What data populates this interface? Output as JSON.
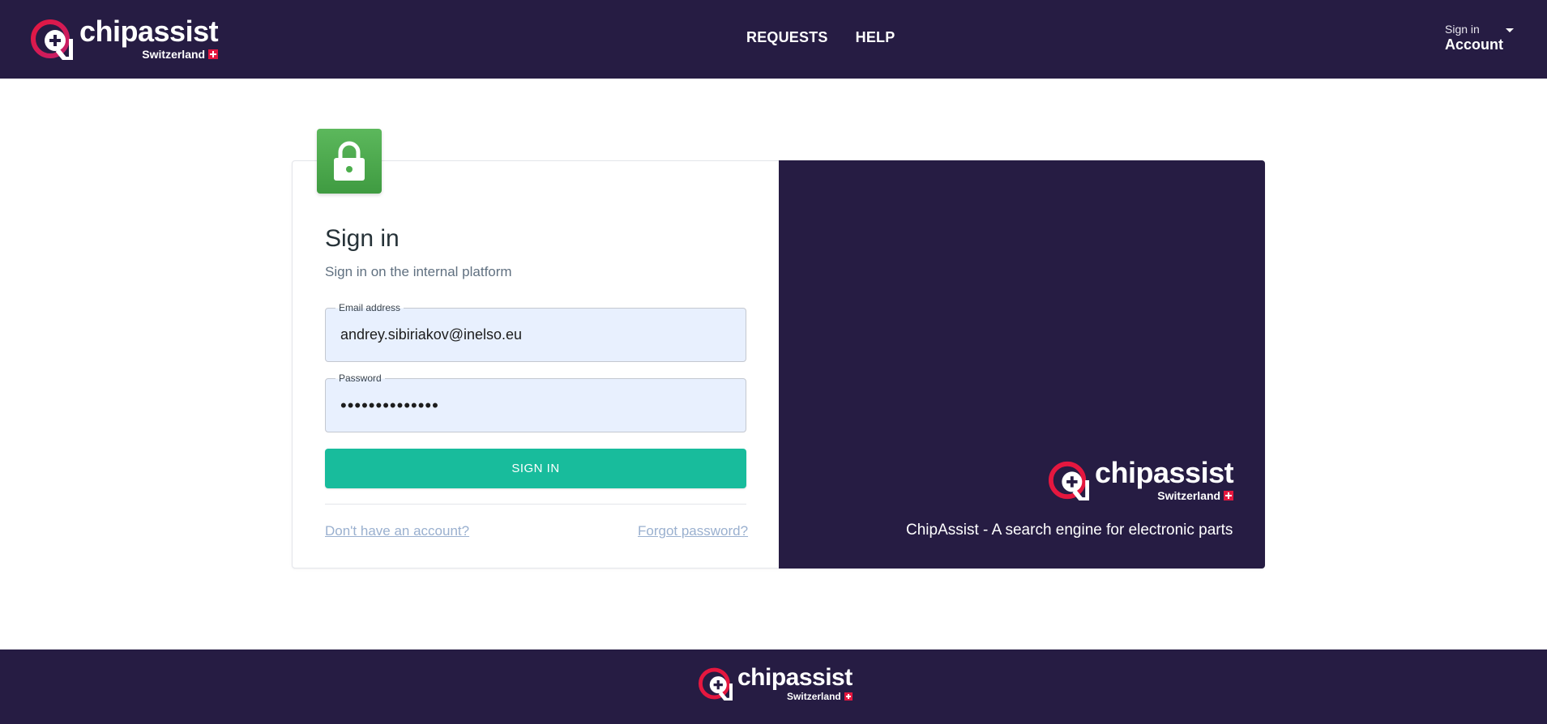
{
  "brand": {
    "name": "chipassist",
    "country": "Switzerland",
    "colors": {
      "navy": "#261c43",
      "accent_red": "#e5173f",
      "teal": "#18bc9c",
      "green": "#4cae4c"
    }
  },
  "header": {
    "nav": [
      {
        "label": "REQUESTS"
      },
      {
        "label": "HELP"
      }
    ],
    "account": {
      "small_label": "Sign in",
      "label": "Account",
      "icon": "caret-down-icon"
    }
  },
  "signin": {
    "lock_icon": "lock-icon",
    "title": "Sign in",
    "subtitle": "Sign in on the internal platform",
    "email": {
      "label": "Email address",
      "value": "andrey.sibiriakov@inelso.eu"
    },
    "password": {
      "label": "Password",
      "value_masked": "••••••••••••••"
    },
    "submit_label": "SIGN IN",
    "register_link": "Don't have an account?",
    "forgot_link": "Forgot password?"
  },
  "promo": {
    "tagline": "ChipAssist - A search engine for electronic parts"
  }
}
